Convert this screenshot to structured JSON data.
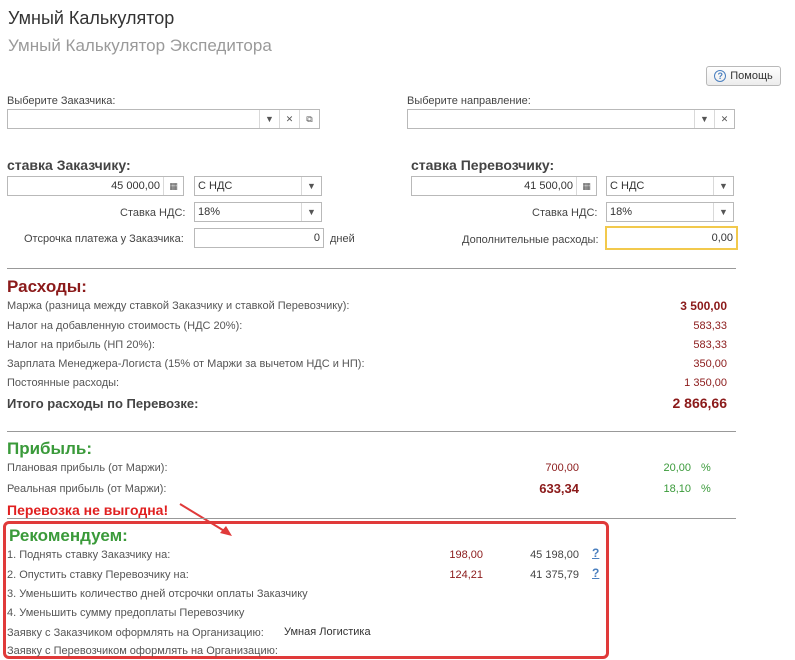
{
  "header": {
    "title": "Умный Калькулятор",
    "subtitle": "Умный Калькулятор Экспедитора",
    "help_label": "Помощь"
  },
  "selectors": {
    "customer_label": "Выберите Заказчика:",
    "customer_value": "",
    "direction_label": "Выберите направление:",
    "direction_value": ""
  },
  "customer_rate": {
    "heading": "ставка Заказчику:",
    "amount": "45 000,00",
    "vat_type": "С НДС",
    "vat_label": "Ставка НДС:",
    "vat_rate": "18%",
    "delay_label": "Отсрочка платежа у Заказчика:",
    "delay_value": "0",
    "delay_unit": "дней"
  },
  "carrier_rate": {
    "heading": "ставка Перевозчику:",
    "amount": "41 500,00",
    "vat_type": "С НДС",
    "vat_label": "Ставка НДС:",
    "vat_rate": "18%",
    "extra_label": "Дополнительные расходы:",
    "extra_value": "0,00"
  },
  "expenses": {
    "heading": "Расходы:",
    "rows": [
      {
        "label": "Маржа (разница между ставкой Заказчику и ставкой Перевозчику):",
        "value": "3 500,00"
      },
      {
        "label": "Налог на добавленную стоимость (НДС 20%):",
        "value": "583,33"
      },
      {
        "label": "Налог на прибыль (НП 20%):",
        "value": "583,33"
      },
      {
        "label": "Зарплата Менеджера-Логиста (15% от Маржи за вычетом НДС и НП):",
        "value": "350,00"
      },
      {
        "label": "Постоянные расходы:",
        "value": "1 350,00"
      }
    ],
    "total_label": "Итого расходы по Перевозке:",
    "total_value": "2 866,66"
  },
  "profit": {
    "heading": "Прибыль:",
    "planned_label": "Плановая прибыль (от Маржи):",
    "planned_value": "700,00",
    "planned_pct": "20,00",
    "real_label": "Реальная прибыль (от Маржи):",
    "real_value": "633,34",
    "real_pct": "18,10",
    "pct_sign": "%"
  },
  "warning": "Перевозка не выгодна!",
  "recommend": {
    "heading": "Рекомендуем:",
    "rows": [
      {
        "label": "1. Поднять ставку Заказчику на:",
        "delta": "198,00",
        "result": "45 198,00",
        "q": "?"
      },
      {
        "label": "2. Опустить ставку Перевозчику на:",
        "delta": "124,21",
        "result": "41 375,79",
        "q": "?"
      }
    ],
    "tip3": "3. Уменьшить количество дней отсрочки оплаты Заказчику",
    "tip4": "4. Уменьшить сумму предоплаты Перевозчику",
    "org_customer_label": "Заявку с Заказчиком оформлять на Организацию:",
    "org_customer_value": "Умная Логистика",
    "org_carrier_label": "Заявку с Перевозчиком оформлять на Организацию:",
    "org_carrier_value": ""
  },
  "colors": {
    "expense_red": "#8b1a1a",
    "profit_green": "#3a9a3a",
    "warning_red": "#e02020",
    "highlight_border": "#e03a3a",
    "active_field": "#f2c94c"
  }
}
